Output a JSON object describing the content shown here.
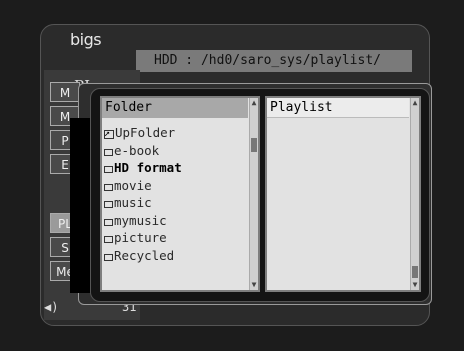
{
  "app": {
    "logo": "bigs",
    "path": "HDD : /hd0/saro_sys/playlist/"
  },
  "background": {
    "page_title": "PL",
    "menu_buttons": [
      {
        "label": "M",
        "active": false
      },
      {
        "label": "M",
        "active": false
      },
      {
        "label": "P",
        "active": false
      },
      {
        "label": "E",
        "active": false
      },
      {
        "label": "PL",
        "active": true
      },
      {
        "label": "S",
        "active": false
      },
      {
        "label": "Me",
        "active": false
      }
    ],
    "volume_icon": "speaker-icon",
    "volume_value": "31"
  },
  "folder_pane": {
    "header": "Folder",
    "items": [
      {
        "label": "UpFolder",
        "icon": "up-folder-icon"
      },
      {
        "label": "e-book",
        "icon": "folder-icon"
      },
      {
        "label": "HD format",
        "icon": "folder-icon",
        "selected": true
      },
      {
        "label": "movie",
        "icon": "folder-icon"
      },
      {
        "label": "music",
        "icon": "folder-icon"
      },
      {
        "label": "mymusic",
        "icon": "folder-icon"
      },
      {
        "label": "picture",
        "icon": "folder-icon"
      },
      {
        "label": "Recycled",
        "icon": "folder-icon"
      }
    ]
  },
  "playlist_pane": {
    "header": "Playlist"
  },
  "glyphs": {
    "scroll_up": "▲",
    "scroll_down": "▼",
    "speaker": "◀)"
  }
}
